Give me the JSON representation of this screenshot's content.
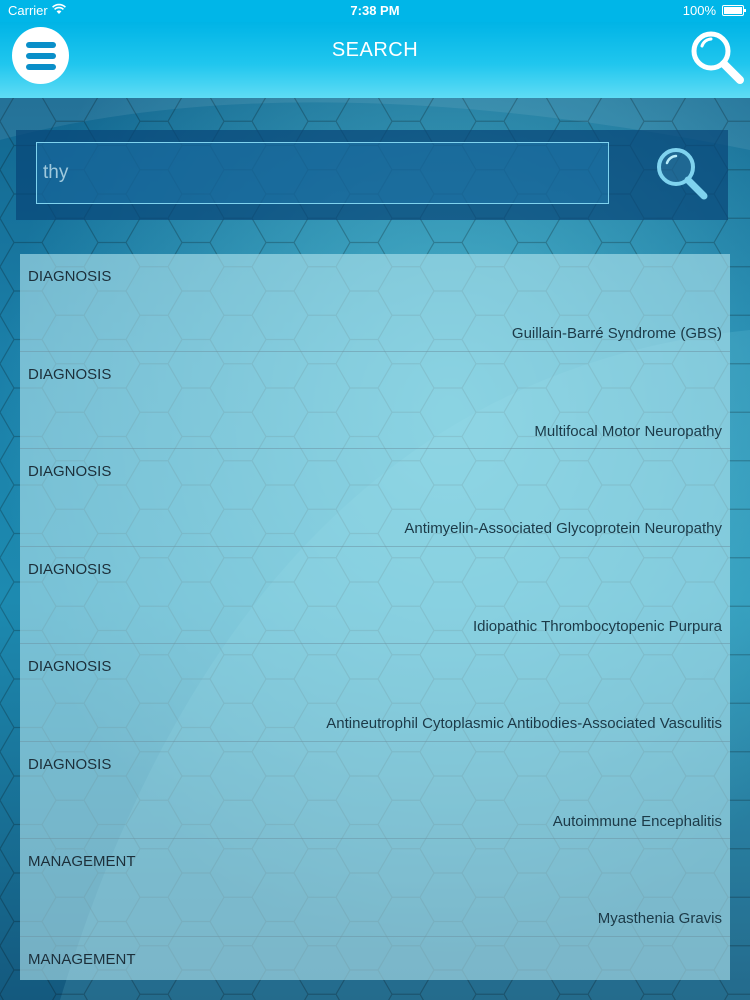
{
  "status_bar": {
    "carrier": "Carrier",
    "time": "7:38 PM",
    "battery": "100%"
  },
  "nav": {
    "title": "SEARCH",
    "menu_icon": "hamburger-menu-icon",
    "search_icon": "magnifier-icon"
  },
  "search": {
    "value": "thy",
    "search_icon": "magnifier-icon"
  },
  "colors": {
    "nav_top": "#00b4e6",
    "nav_bottom": "#5fdcf5",
    "menu_button_bg": "#ffffff",
    "menu_bars": "#0a8fc9"
  },
  "results": [
    {
      "category": "DIAGNOSIS",
      "title": "Guillain-Barré Syndrome (GBS)"
    },
    {
      "category": "DIAGNOSIS",
      "title": "Multifocal Motor Neuropathy"
    },
    {
      "category": "DIAGNOSIS",
      "title": "Antimyelin-Associated Glycoprotein Neuropathy"
    },
    {
      "category": "DIAGNOSIS",
      "title": "Idiopathic Thrombocytopenic Purpura"
    },
    {
      "category": "DIAGNOSIS",
      "title": "Antineutrophil Cytoplasmic Antibodies-Associated Vasculitis"
    },
    {
      "category": "DIAGNOSIS",
      "title": "Autoimmune Encephalitis"
    },
    {
      "category": "MANAGEMENT",
      "title": "Myasthenia Gravis"
    },
    {
      "category": "MANAGEMENT",
      "title": ""
    }
  ]
}
